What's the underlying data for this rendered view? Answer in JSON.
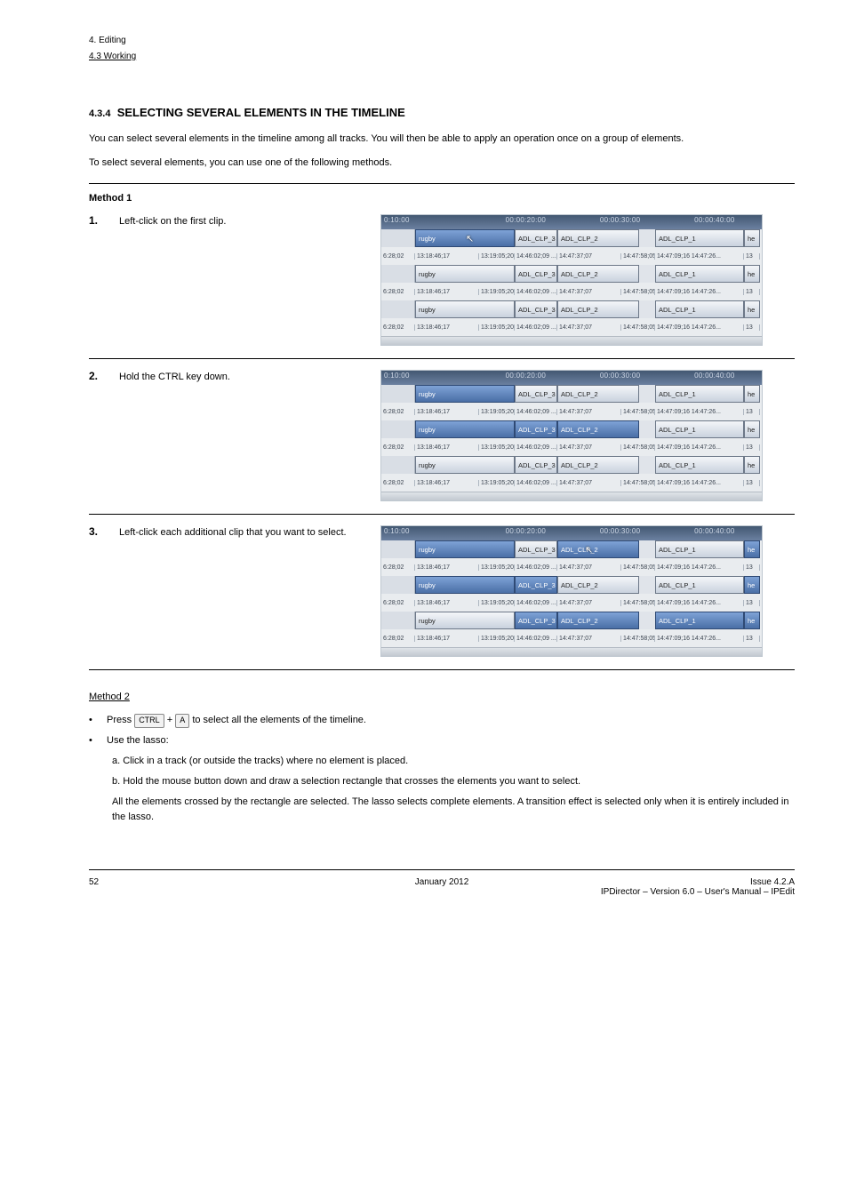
{
  "header": {
    "chapter": "4. Editing",
    "underline": "4.3 Working"
  },
  "section1": {
    "num": "4.3.4",
    "title": "SELECTING SEVERAL ELEMENTS IN THE TIMELINE",
    "p1": "You can select several elements in the timeline among all tracks. You will then be able to apply an operation once on a group of elements.",
    "p2": "To select several elements, you can use one of the following methods."
  },
  "method_label": "Method 1",
  "steps": [
    {
      "n": "1.",
      "text": "Left-click on the first clip."
    },
    {
      "n": "2.",
      "text": "Hold the CTRL key down."
    },
    {
      "n": "3.",
      "text": "Left-click each additional clip that you want to select."
    }
  ],
  "method2": {
    "heading": "Method 2",
    "rows": [
      {
        "dot": "•",
        "text_a": "Press ",
        "key": "CTRL",
        "text_b": " + ",
        "key2": "A",
        "text_c": " to select all the elements of the timeline."
      },
      {
        "dot": "•",
        "text": "Use the lasso:"
      },
      {
        "dot": "",
        "sub_a": "a.  Click in a track (or outside the tracks) where no element is placed."
      },
      {
        "dot": "",
        "sub_b": "b.  Hold the mouse button down and draw a selection rectangle that crosses the elements you want to select."
      },
      {
        "dot": "",
        "small": "All the elements crossed by the rectangle are selected. The lasso selects complete elements. A transition effect is selected only when it is entirely included in the lasso."
      }
    ]
  },
  "ruler": {
    "t1": "0:10:00",
    "t2": "00:00:20:00",
    "t3": "00:00:30:00",
    "t4": "00:00:40:00"
  },
  "clips": {
    "rugby": "rugby",
    "c3": "ADL_CLP_3",
    "c2": "ADL_CLP_2",
    "c1": "ADL_CLP_1",
    "he": "he"
  },
  "tc": {
    "a": "6:28;02",
    "b": "13:18:46;17",
    "c": "13:19:05;20",
    "d": "14:46:02;09 ...",
    "e": "14:47:37;07",
    "f": "14:47:58;05",
    "g": "14:47:09;16 14:47:26...",
    "h": "13"
  },
  "footer": {
    "left": "52",
    "mid": "January 2012",
    "right_a": "Issue 4.2.A",
    "right_b": "IPDirector – Version 6.0 – User's Manual – IPEdit"
  }
}
